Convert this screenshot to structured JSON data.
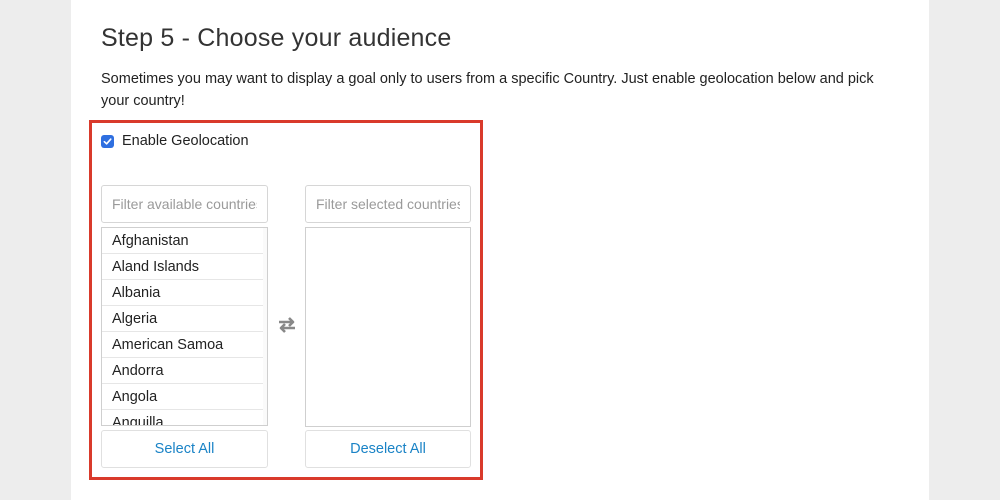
{
  "step": {
    "title": "Step 5 - Choose your audience",
    "description": "Sometimes you may want to display a goal only to users from a specific Country. Just enable geolocation below and pick your country!"
  },
  "geolocation": {
    "label": "Enable Geolocation",
    "checked": true
  },
  "available": {
    "filter_placeholder": "Filter available countries",
    "items": [
      "Afghanistan",
      "Aland Islands",
      "Albania",
      "Algeria",
      "American Samoa",
      "Andorra",
      "Angola",
      "Anguilla"
    ],
    "button_label": "Select All"
  },
  "selected": {
    "filter_placeholder": "Filter selected countries",
    "items": [],
    "button_label": "Deselect All"
  },
  "icons": {
    "swap": "swap-arrows-icon",
    "check": "check-icon"
  },
  "colors": {
    "highlight_border": "#d93a2b",
    "checkbox": "#2f6fe0",
    "button_text": "#1a83c6"
  }
}
